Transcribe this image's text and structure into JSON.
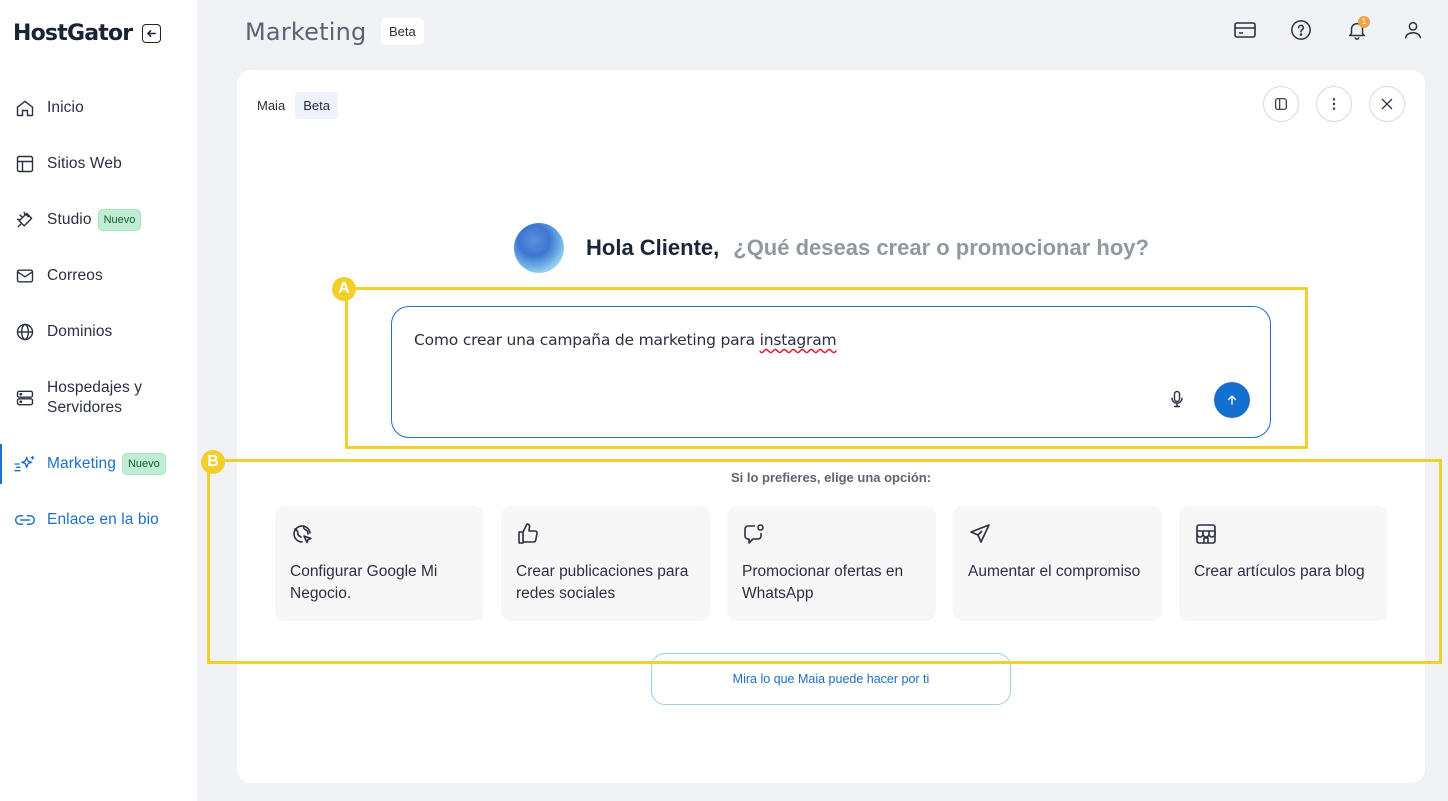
{
  "brand": {
    "logo_text": "HostGator"
  },
  "sidebar": {
    "items": [
      {
        "label": "Inicio",
        "icon": "home-icon"
      },
      {
        "label": "Sitios Web",
        "icon": "layout-icon"
      },
      {
        "label": "Studio",
        "icon": "studio-icon",
        "badge": "Nuevo"
      },
      {
        "label": "Correos",
        "icon": "mail-icon"
      },
      {
        "label": "Dominios",
        "icon": "globe-icon"
      },
      {
        "label": "Hospedajes y Servidores",
        "icon": "server-icon"
      },
      {
        "label": "Marketing",
        "icon": "sparkle-icon",
        "badge": "Nuevo",
        "active": true
      },
      {
        "label": "Enlace en la bio",
        "icon": "link-icon"
      }
    ]
  },
  "header": {
    "title": "Marketing",
    "beta": "Beta",
    "notification_count": "1"
  },
  "panel": {
    "title": "Maia",
    "beta": "Beta",
    "greeting_name": "Hola Cliente,",
    "greeting_question": "¿Qué deseas crear o promocionar hoy?",
    "input_text_before": "Como crear una campaña de marketing para ",
    "input_text_misspelled": "instagram",
    "options_caption": "Si lo prefieres, elige una opción:",
    "options": [
      {
        "label": "Configurar Google Mi Negocio.",
        "icon": "google-business-icon"
      },
      {
        "label": "Crear publicaciones para redes sociales",
        "icon": "thumbs-up-icon"
      },
      {
        "label": "Promocionar ofertas en WhatsApp",
        "icon": "chat-icon"
      },
      {
        "label": "Aumentar el compromiso",
        "icon": "send-icon"
      },
      {
        "label": "Crear artículos para blog",
        "icon": "store-icon"
      }
    ],
    "see_more_text": "Mira lo que Maia puede hacer por ti"
  },
  "annotations": {
    "a": "A",
    "b": "B"
  },
  "colors": {
    "accent": "#1d6fc8",
    "annotation": "#f2cf2b",
    "badge_bg": "#bfeed2"
  }
}
